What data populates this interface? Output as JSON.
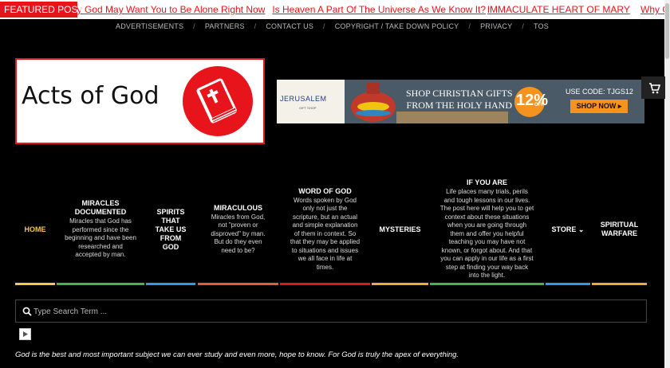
{
  "ticker": {
    "label": "FEATURED POST",
    "items": [
      "hy God May Want You to Be Alone Right Now",
      "Is Heaven A Part Of The Universe As We Know It?",
      "IMMACULATE HEART OF MARY",
      "Why G"
    ]
  },
  "top_links": [
    "ADVERTISEMENTS",
    "PARTNERS",
    "CONTACT US",
    "COPYRIGHT / TAKE DOWN POLICY",
    "PRIVACY",
    "TOS"
  ],
  "logo": {
    "text": "Acts of God"
  },
  "banner": {
    "logo": "JERUSALEM",
    "logo_sub": "GIFT SHOP",
    "headline_1": "SHOP CHRISTIAN GIFTS",
    "headline_2": "FROM THE HOLY HAND",
    "percent": "12%",
    "off": "OFF",
    "code": "USE CODE: TJGS12",
    "cta": "SHOP NOW ▸"
  },
  "nav": [
    {
      "title": "HOME",
      "desc": ""
    },
    {
      "title": "MIRACLES DOCUMENTED",
      "desc": "Miracles that God has performed since the beginning and have been researched and accepted by man."
    },
    {
      "title": "SPIRITS THAT TAKE US FROM GOD",
      "desc": ""
    },
    {
      "title": "MIRACULOUS",
      "desc": "Miracles from God, not \"proven or disproved\" by man. But do they even need to be?"
    },
    {
      "title": "WORD OF GOD",
      "desc": "Words spoken by God only not just the scripture, but an actual and simple explanation of them in context. So that they may be applied to situations and issues we all face in life at times."
    },
    {
      "title": "MYSTERIES",
      "desc": ""
    },
    {
      "title": "IF YOU ARE",
      "desc": "Life places many trials, perils and tough lessons in our lives. The post here will help you to get context about these situations when you are going through them and offer you helpful teaching you may have not known, or forgot about. And that you can apply in our life as a first step at finding your way back into the light."
    },
    {
      "title": "STORE ⌄",
      "desc": ""
    },
    {
      "title": "SPIRITUAL WARFARE",
      "desc": ""
    }
  ],
  "colors": {
    "accent_red": "#e8141b",
    "nav_bars": [
      "#f2c94c",
      "#4caf50",
      "#2f9be0",
      "#e85d2f",
      "#e8141b",
      "#f2a640",
      "#4caf50",
      "#2f9be0",
      "#f2a640"
    ]
  },
  "search": {
    "placeholder": "Type Search Term ..."
  },
  "tagline": "God is the best and most important subject we can ever study and even more, hope to know. For God is truly the apex of everything.",
  "icons": {
    "search": "search-icon",
    "cart": "cart-icon",
    "play": "play-icon",
    "bible": "bible-icon"
  }
}
